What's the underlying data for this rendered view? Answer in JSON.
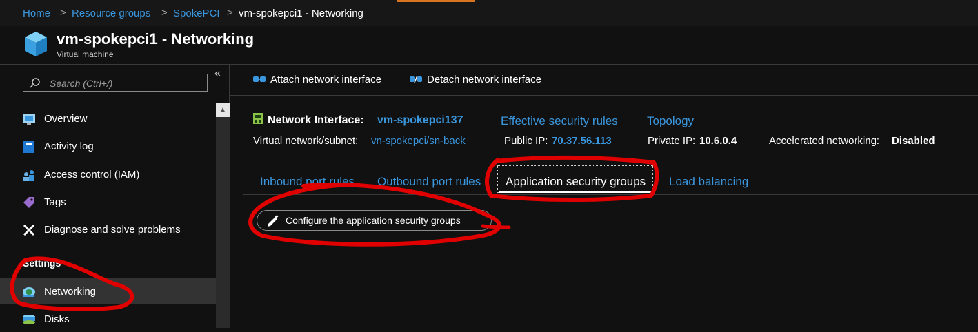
{
  "breadcrumb": {
    "items": [
      "Home",
      "Resource groups",
      "SpokePCI"
    ],
    "current": "vm-spokepci1 - Networking",
    "separator": ">"
  },
  "header": {
    "title": "vm-spokepci1 - Networking",
    "subtitle": "Virtual machine",
    "icon": "vm-cube-icon"
  },
  "sidebar": {
    "search_placeholder": "Search (Ctrl+/)",
    "collapse_glyph": "«",
    "items": [
      {
        "label": "Overview",
        "icon": "overview-icon"
      },
      {
        "label": "Activity log",
        "icon": "activity-log-icon"
      },
      {
        "label": "Access control (IAM)",
        "icon": "iam-icon"
      },
      {
        "label": "Tags",
        "icon": "tag-icon"
      },
      {
        "label": "Diagnose and solve problems",
        "icon": "wrench-icon"
      }
    ],
    "section_header": "Settings",
    "settings_items": [
      {
        "label": "Networking",
        "icon": "networking-icon",
        "selected": true
      },
      {
        "label": "Disks",
        "icon": "disks-icon"
      }
    ]
  },
  "toolbar": {
    "attach_label": "Attach network interface",
    "detach_label": "Detach network interface"
  },
  "nic": {
    "label": "Network Interface:",
    "name": "vm-spokepci137",
    "effective_rules": "Effective security rules",
    "topology": "Topology",
    "vnet_label": "Virtual network/subnet:",
    "vnet_value": "vn-spokepci/sn-back",
    "public_ip_label": "Public IP:",
    "public_ip_value": "70.37.56.113",
    "private_ip_label": "Private IP:",
    "private_ip_value": "10.6.0.4",
    "accel_label": "Accelerated networking:",
    "accel_value": "Disabled"
  },
  "tabs": [
    {
      "label": "Inbound port rules",
      "active": false
    },
    {
      "label": "Outbound port rules",
      "active": false
    },
    {
      "label": "Application security groups",
      "active": true
    },
    {
      "label": "Load balancing",
      "active": false
    }
  ],
  "configure_button": "Configure the application security groups",
  "colors": {
    "background": "#111111",
    "link": "#3a96dd",
    "accent_orange": "#d8731f",
    "annotation_red": "#e00000",
    "selected_nav": "#333333"
  }
}
